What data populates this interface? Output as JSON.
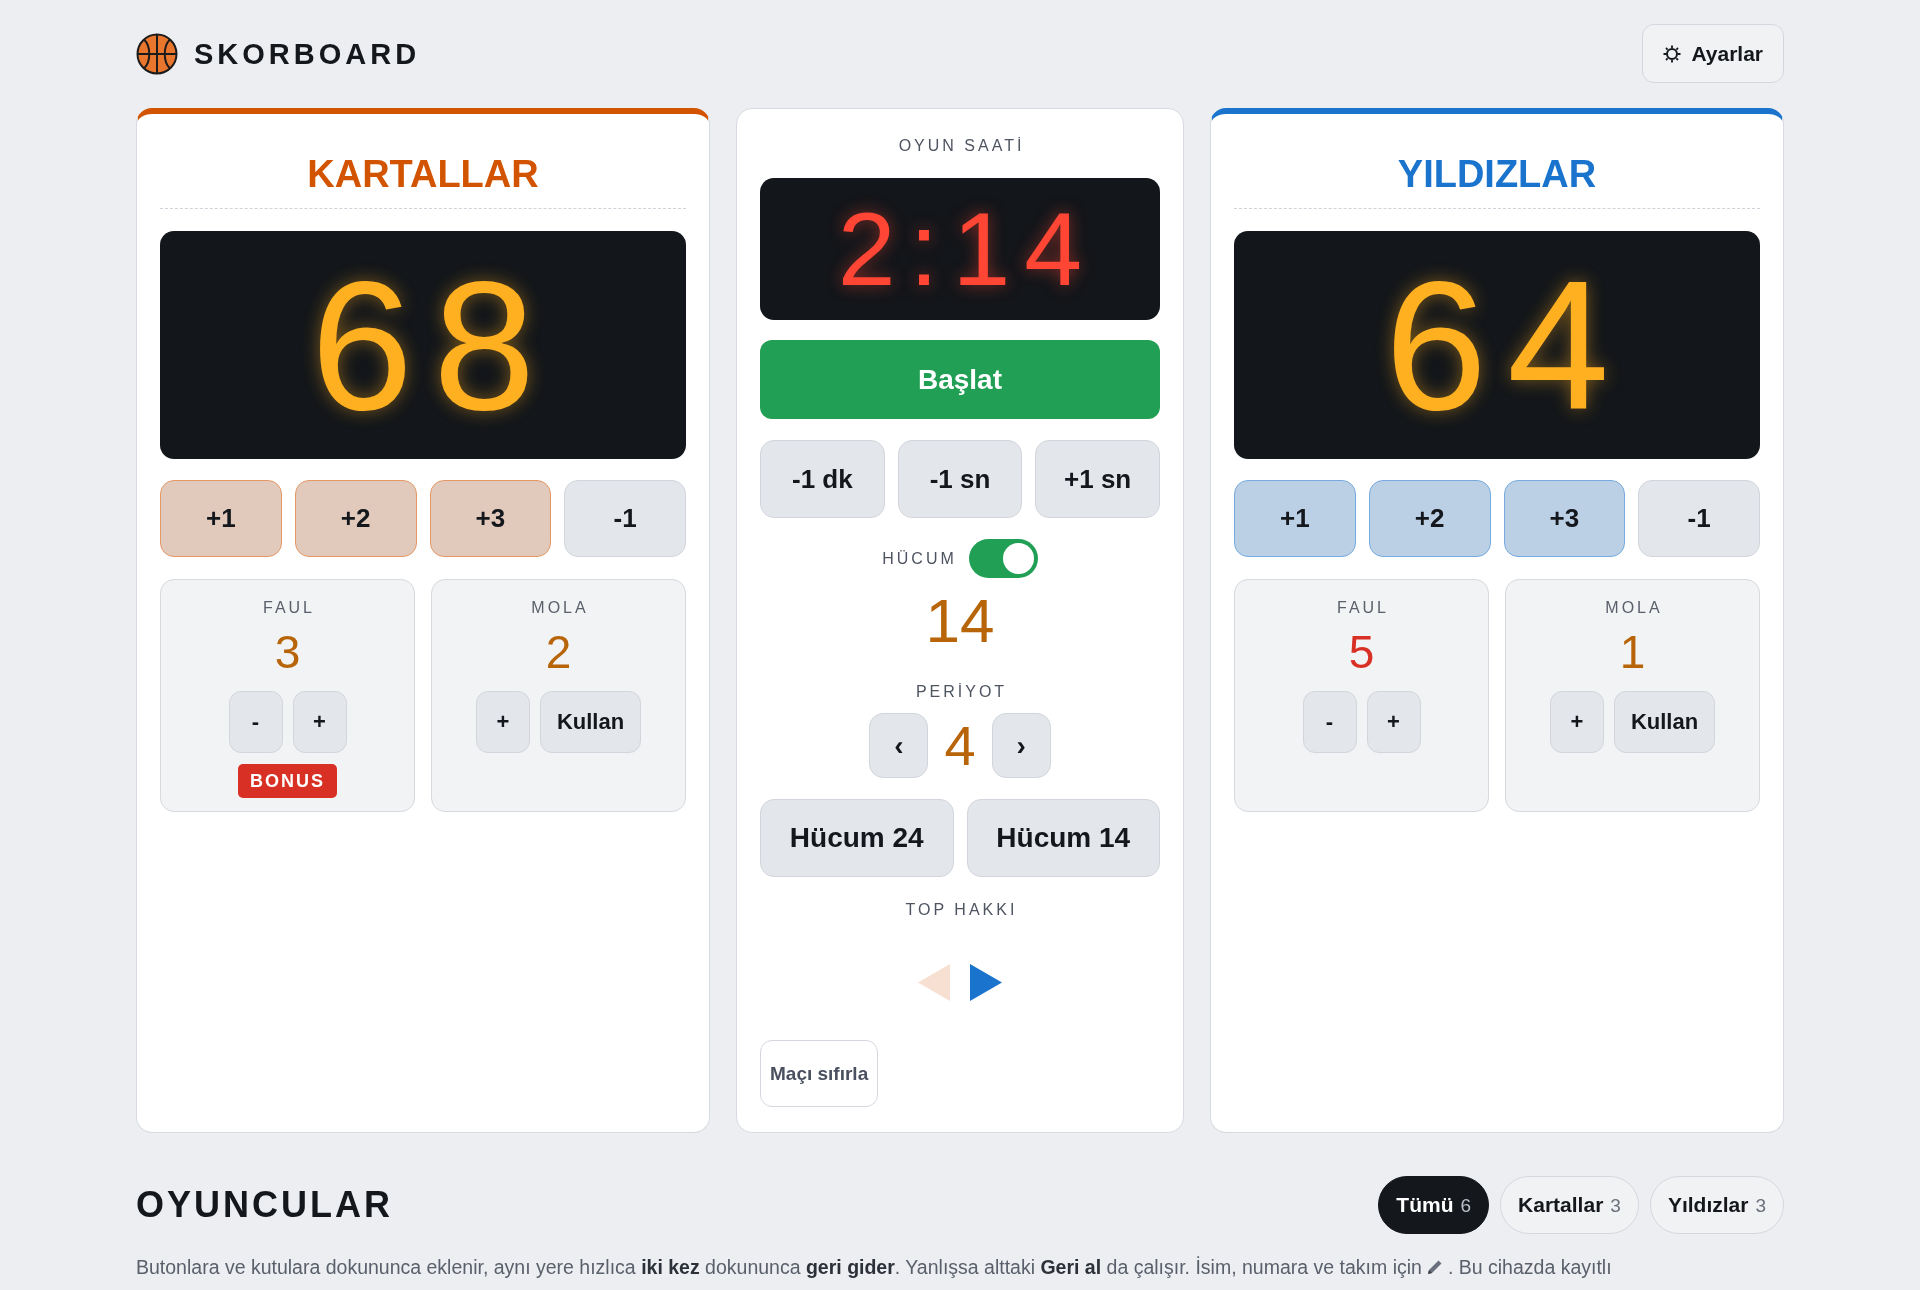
{
  "header": {
    "title": "SKORBOARD",
    "settings_button": "Ayarlar"
  },
  "teams": [
    {
      "name": "KARTALLAR",
      "color": "#d35400",
      "score": "68",
      "score_buttons": [
        {
          "label": "+1",
          "kind": "add"
        },
        {
          "label": "+2",
          "kind": "add"
        },
        {
          "label": "+3",
          "kind": "add"
        },
        {
          "label": "-1",
          "kind": "undo"
        }
      ],
      "fouls": {
        "label": "FAUL",
        "value": "3",
        "warning": false,
        "buttons": [
          "-",
          "+"
        ],
        "badge": "BONUS"
      },
      "timeouts": {
        "label": "MOLA",
        "value": "2",
        "buttons": [
          "+",
          "Kullan"
        ]
      }
    },
    {
      "name": "YILDIZLAR",
      "color": "#1a73cc",
      "score": "64",
      "score_buttons": [
        {
          "label": "+1",
          "kind": "add"
        },
        {
          "label": "+2",
          "kind": "add"
        },
        {
          "label": "+3",
          "kind": "add"
        },
        {
          "label": "-1",
          "kind": "undo"
        }
      ],
      "fouls": {
        "label": "FAUL",
        "value": "5",
        "warning": true,
        "buttons": [
          "-",
          "+"
        ]
      },
      "timeouts": {
        "label": "MOLA",
        "value": "1",
        "buttons": [
          "+",
          "Kullan"
        ]
      }
    }
  ],
  "clock": {
    "label": "OYUN SAATİ",
    "time": "2:14",
    "start_button": "Başlat",
    "adjust_buttons": [
      "-1 dk",
      "-1 sn",
      "+1 sn"
    ]
  },
  "shot_clock": {
    "label": "HÜCUM",
    "on": true,
    "value": "14"
  },
  "period": {
    "label": "PERİYOT",
    "previous": "‹",
    "value": "4",
    "next": "›"
  },
  "shot_clock_buttons": [
    "Hücum 24",
    "Hücum 14"
  ],
  "possession": {
    "label": "TOP HAKKI",
    "arrows": [
      {
        "kind": "left",
        "selected": false
      },
      {
        "kind": "right",
        "selected": true
      }
    ]
  },
  "reset_button": "Maçı sıfırla",
  "players": {
    "title": "OYUNCULAR",
    "filters": [
      {
        "label": "Tümü",
        "count": "6",
        "selected": true
      },
      {
        "label": "Kartallar",
        "count": "3",
        "selected": false
      },
      {
        "label": "Yıldızlar",
        "count": "3",
        "selected": false
      }
    ],
    "hint": [
      "Butonlara ve kutulara dokununca eklenir, aynı yere hızlıca **iki kez** dokununca **geri gider**. Yanlışsa alttaki **Geri al** da çalışır. İsim, numara ve takım için",
      ". Bu cihazda kayıtlı"
    ]
  }
}
